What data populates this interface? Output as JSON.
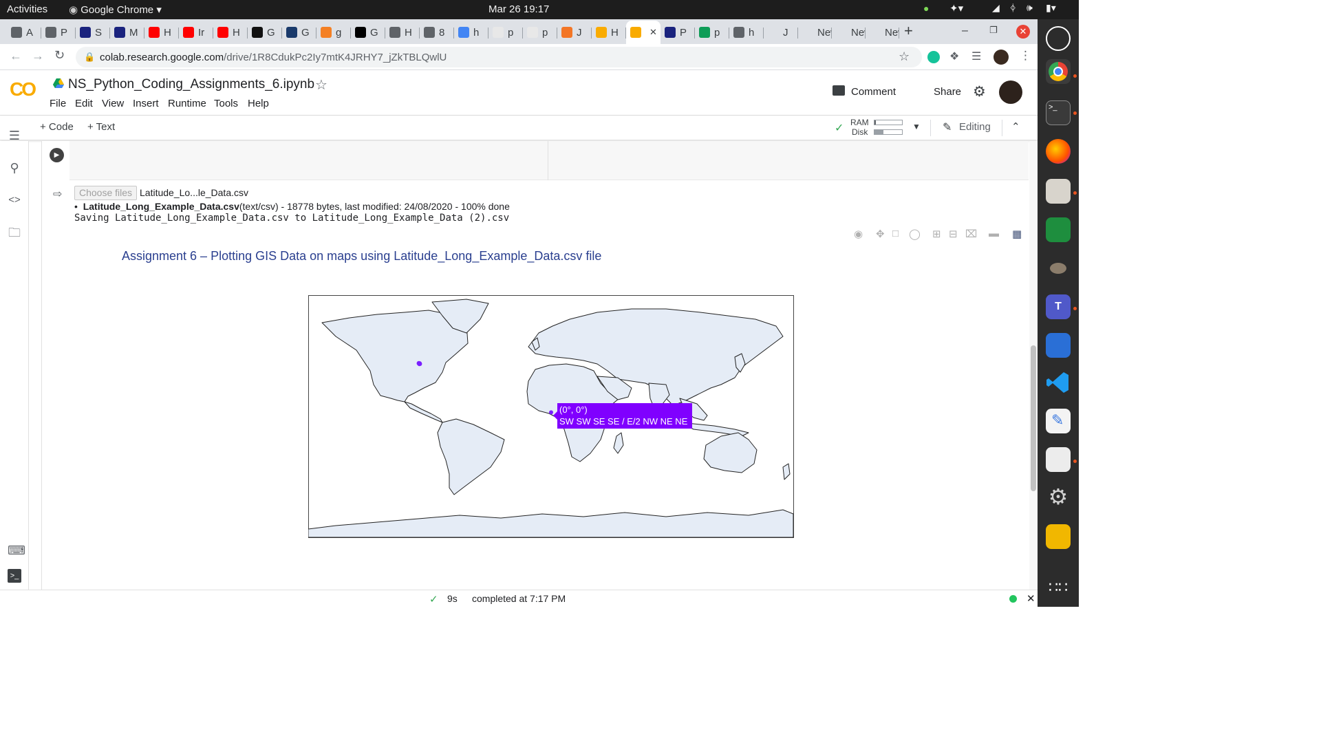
{
  "topbar": {
    "activities": "Activities",
    "app_name": "Google Chrome",
    "clock": "Mar 26  19:17"
  },
  "tabs": [
    {
      "label": "A",
      "icon_color": "#5f6368"
    },
    {
      "label": "P",
      "icon_color": "#5f6368"
    },
    {
      "label": "S",
      "icon_color": "#1a237e"
    },
    {
      "label": "M",
      "icon_color": "#1a237e"
    },
    {
      "label": "H",
      "icon_color": "#ff0000"
    },
    {
      "label": "Ir",
      "icon_color": "#ff0000"
    },
    {
      "label": "H",
      "icon_color": "#ff0000"
    },
    {
      "label": "G",
      "icon_color": "#111111"
    },
    {
      "label": "G",
      "icon_color": "#1a3a6b"
    },
    {
      "label": "g",
      "icon_color": "#f48024"
    },
    {
      "label": "G",
      "icon_color": "#000000"
    },
    {
      "label": "H",
      "icon_color": "#5f6368"
    },
    {
      "label": "8",
      "icon_color": "#5f6368"
    },
    {
      "label": "h",
      "icon_color": "#4285f4"
    },
    {
      "label": "p",
      "icon_color": "#e8e8e8"
    },
    {
      "label": "p",
      "icon_color": "#e8e8e8"
    },
    {
      "label": "J",
      "icon_color": "#f37626"
    },
    {
      "label": "H",
      "icon_color": "#f9ab00"
    },
    {
      "label": "",
      "icon_color": "#f9ab00",
      "active": true
    },
    {
      "label": "P",
      "icon_color": "#1a237e"
    },
    {
      "label": "p",
      "icon_color": "#0f9d58"
    },
    {
      "label": "h",
      "icon_color": "#5f6368"
    },
    {
      "label": "J",
      "icon_color": "#dee1e6"
    },
    {
      "label": "New",
      "icon_color": "#dee1e6"
    },
    {
      "label": "New",
      "icon_color": "#dee1e6"
    },
    {
      "label": "New",
      "icon_color": "#dee1e6"
    }
  ],
  "new_tab_symbol": "+",
  "address": {
    "host": "colab.research.google.com",
    "path": "/drive/1R8CdukPc2Iy7mtK4JRHY7_jZkTBLQwlU"
  },
  "colab": {
    "logo": "CO",
    "notebook_title": "NS_Python_Coding_Assignments_6.ipynb",
    "menu": [
      "File",
      "Edit",
      "View",
      "Insert",
      "Runtime",
      "Tools",
      "Help"
    ],
    "comment_label": "Comment",
    "share_label": "Share",
    "add_code": "+ Code",
    "add_text": "+ Text",
    "ram_label": "RAM",
    "disk_label": "Disk",
    "ram_fill": 0.04,
    "disk_fill": 0.32,
    "editing_label": "Editing"
  },
  "output": {
    "choose_files": "Choose files",
    "file_short": "Latitude_Lo...le_Data.csv",
    "file_name_bold": "Latitude_Long_Example_Data.csv",
    "file_details": "(text/csv) - 18778 bytes, last modified: 24/08/2020 - 100% done",
    "saving_line": "Saving Latitude_Long_Example_Data.csv to Latitude_Long_Example_Data (2).csv",
    "plot_title": "Assignment 6 – Plotting GIS Data on maps using Latitude_Long_Example_Data.csv file",
    "hover_line1": "(0°, 0°)",
    "hover_line2": "SW SW SE SE / E/2 NW NE NE"
  },
  "chart_data": {
    "type": "scatter",
    "title": "Assignment 6 – Plotting GIS Data on maps using Latitude_Long_Example_Data.csv file",
    "projection": "equirectangular",
    "marker_color": "#7a1fff",
    "points": [
      {
        "lat": 0,
        "lon": 0,
        "label": "SW SW SE SE / E/2 NW NE NE"
      },
      {
        "lat": 35.1,
        "lon": -98.1
      },
      {
        "lat": 35.0,
        "lon": -97.9
      },
      {
        "lat": 34.8,
        "lon": -97.7
      },
      {
        "lat": 35.2,
        "lon": -97.5
      },
      {
        "lat": 34.9,
        "lon": -97.3
      },
      {
        "lat": 35.3,
        "lon": -98.0
      },
      {
        "lat": 34.6,
        "lon": -97.6
      },
      {
        "lat": 35.1,
        "lon": -97.4
      },
      {
        "lat": 34.7,
        "lon": -97.2
      }
    ]
  },
  "status": {
    "duration": "9s",
    "completed": "completed at 7:17 PM"
  },
  "colors": {
    "colab_orange": "#f9ab00",
    "title_blue": "#2a3f8f",
    "land": "#e5ecf6",
    "hover_bg": "#8000ff"
  }
}
